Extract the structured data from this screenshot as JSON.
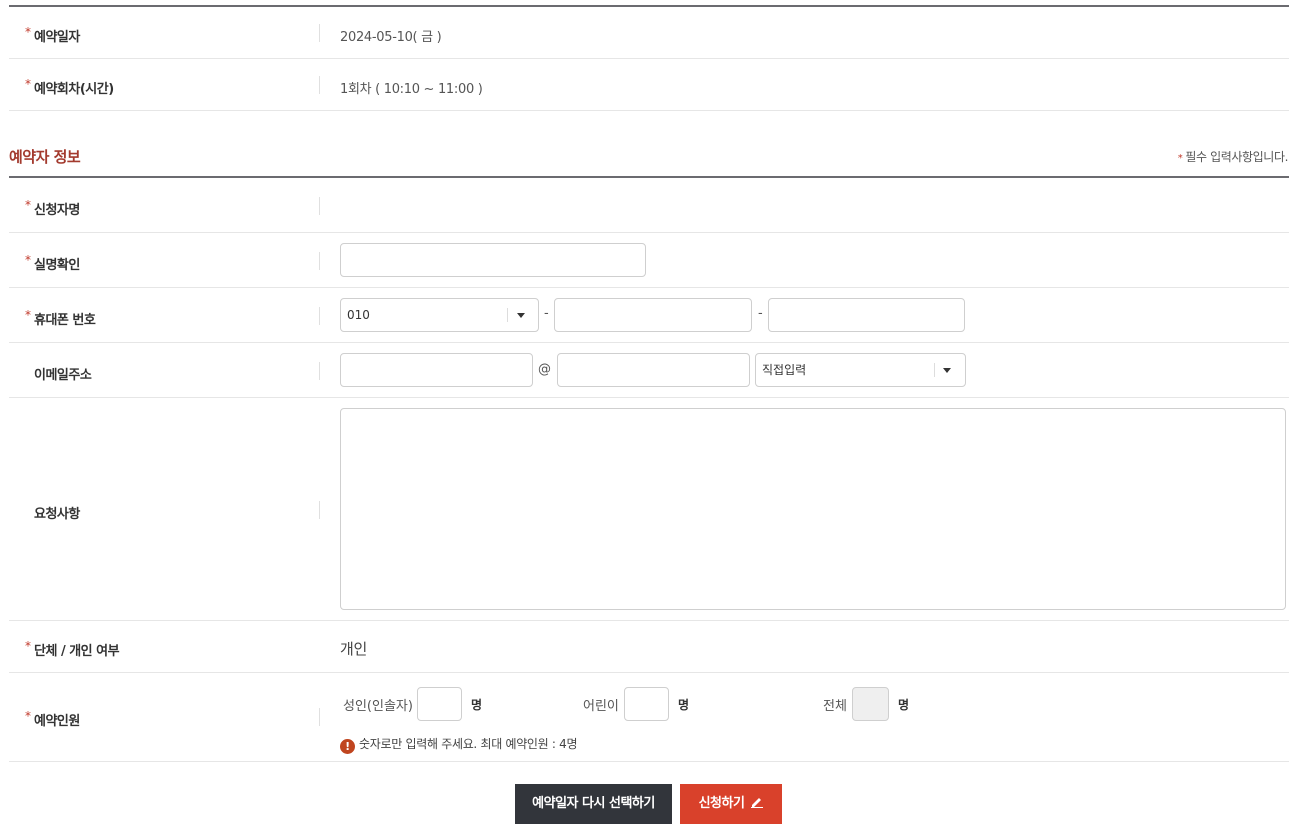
{
  "reservation": {
    "date_label": "예약일자",
    "date_value": "2024-05-10( 금 )",
    "session_label": "예약회차(시간)",
    "session_value": "1회차 ( 10:10 ~ 11:00 )"
  },
  "section": {
    "title": "예약자 정보",
    "required_note": "필수 입력사항입니다.",
    "required_mark": "*"
  },
  "form": {
    "applicant_label": "신청자명",
    "applicant_value": "",
    "realname_label": "실명확인",
    "phone_label": "휴대폰 번호",
    "phone_prefix": "010",
    "phone_dash": "-",
    "email_label": "이메일주소",
    "email_at": "@",
    "email_domain_select": "직접입력",
    "request_label": "요청사항",
    "group_label": "단체 / 개인 여부",
    "group_value": "개인",
    "people_label": "예약인원",
    "adult_label": "성인(인솔자)",
    "child_label": "어린이",
    "total_label": "전체",
    "unit": "명",
    "notice": "숫자로만 입력해 주세요. 최대 예약인원 : 4명",
    "notice_icon": "!"
  },
  "buttons": {
    "reselect": "예약일자 다시 선택하기",
    "submit": "신청하기"
  },
  "colors": {
    "accent_red": "#d9412b",
    "dark_button": "#32353b",
    "section_title": "#a33a2e"
  }
}
